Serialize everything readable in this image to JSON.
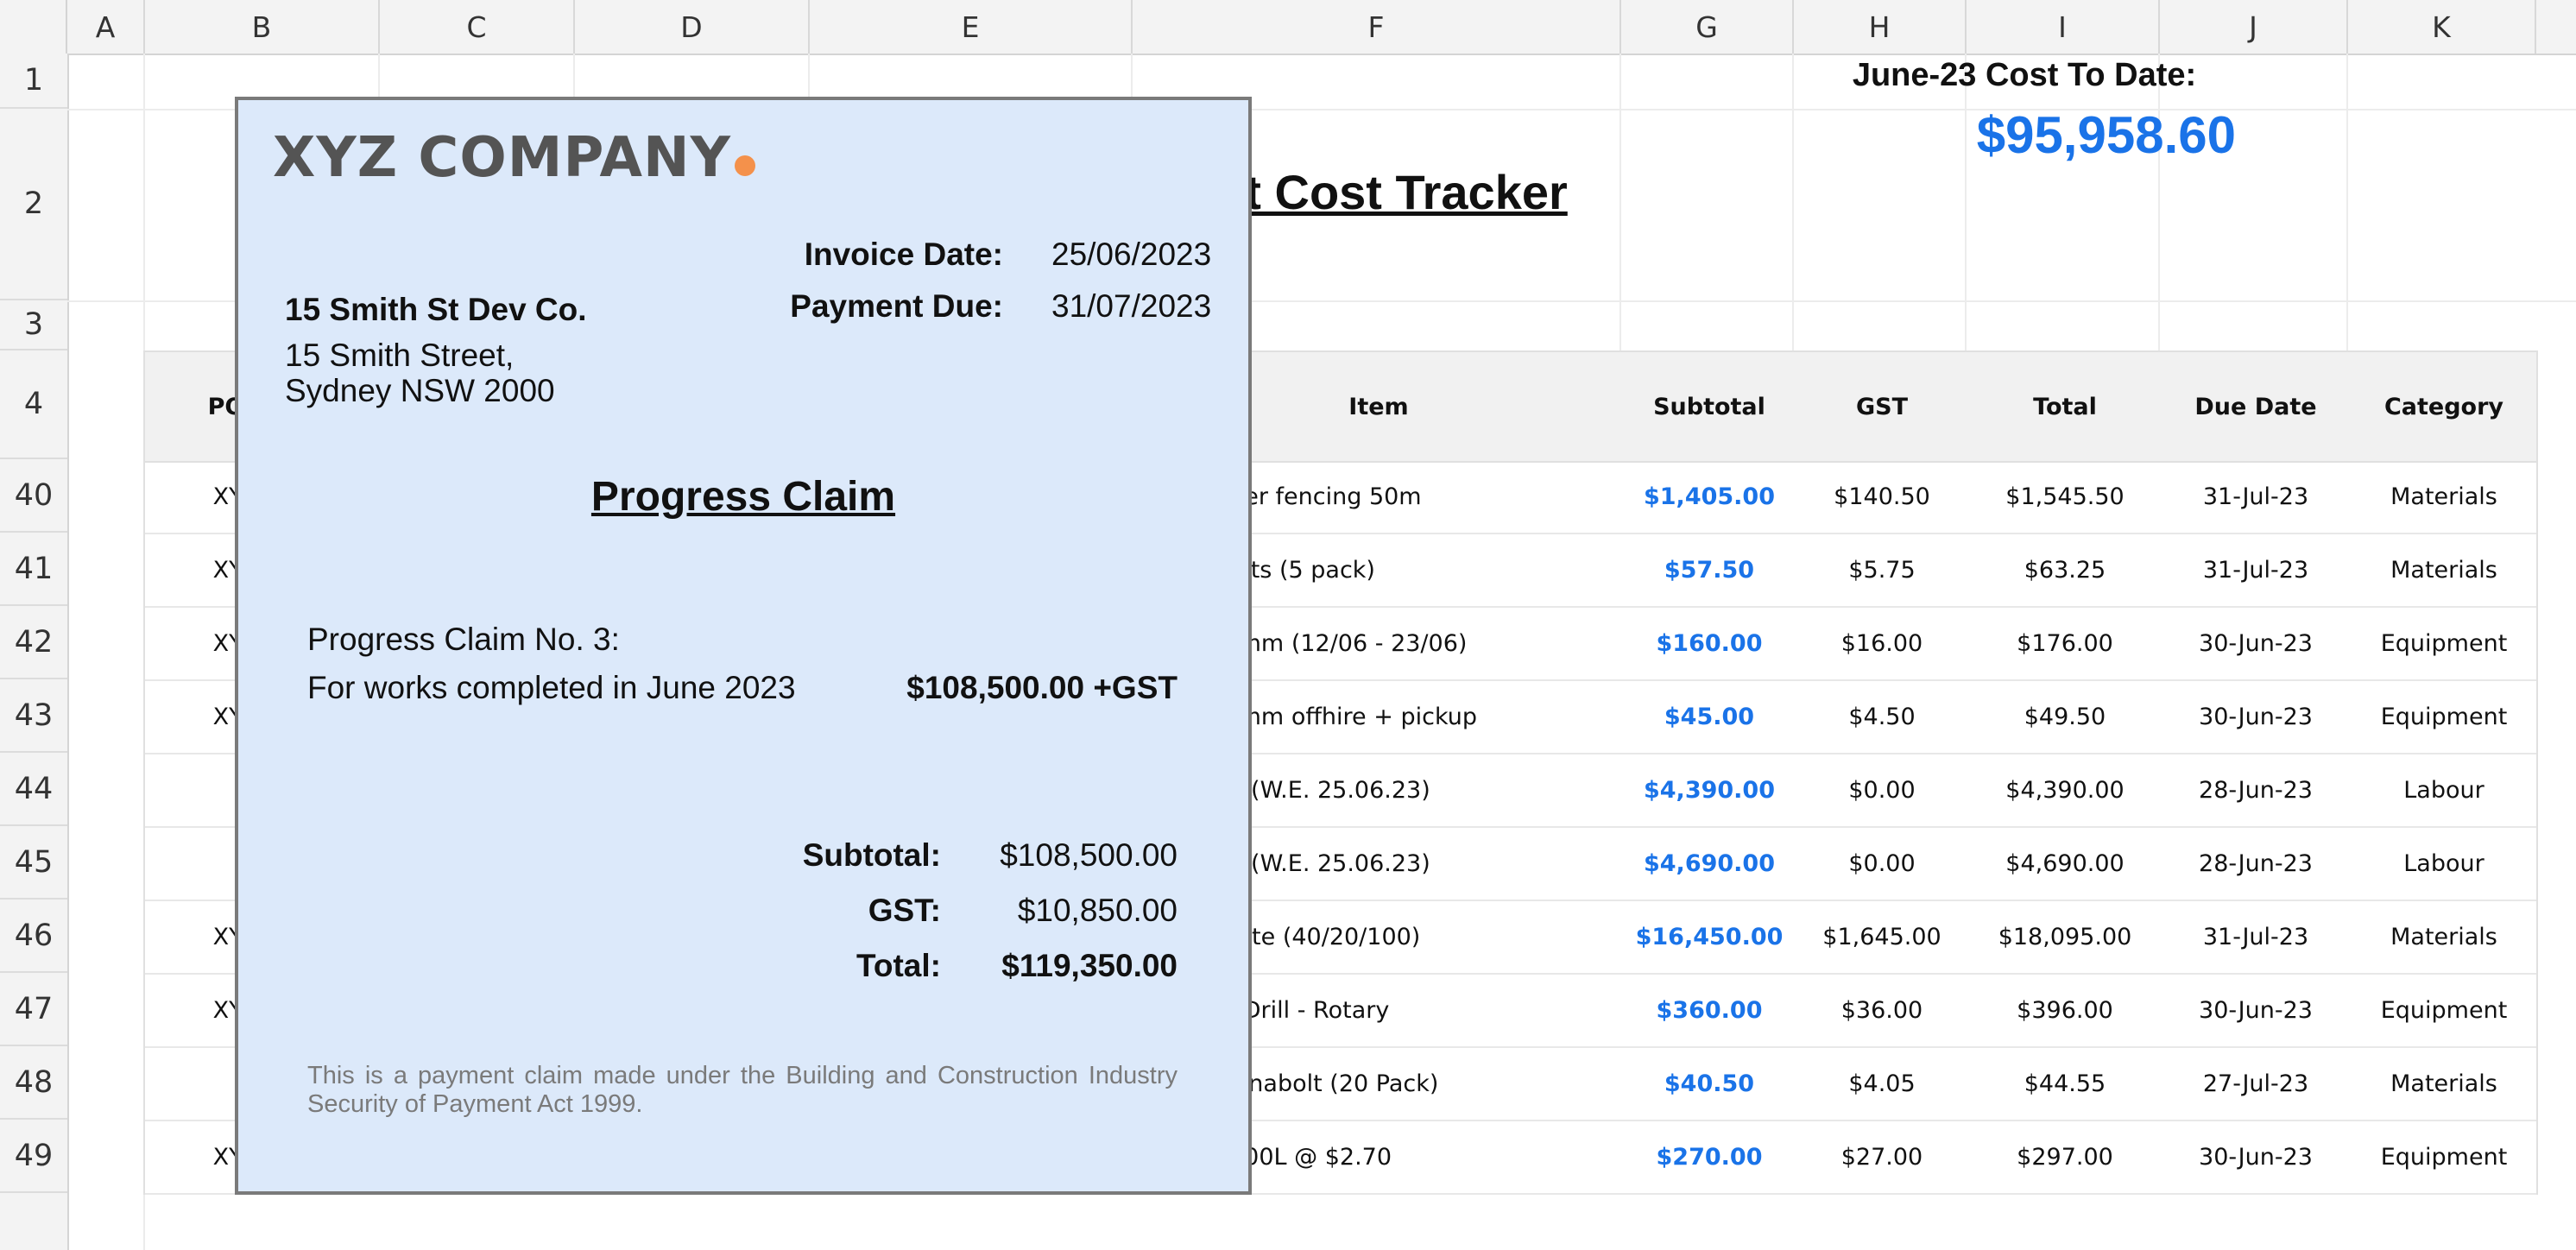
{
  "columns": [
    "A",
    "B",
    "C",
    "D",
    "E",
    "F",
    "G",
    "H",
    "I",
    "J",
    "K"
  ],
  "rows": [
    "1",
    "2",
    "3",
    "4",
    "40",
    "41",
    "42",
    "43",
    "44",
    "45",
    "46",
    "47",
    "48",
    "49"
  ],
  "cost_to_date": {
    "label": "June-23 Cost To Date:",
    "value": "$95,958.60"
  },
  "sheet_title": "ect Cost Tracker",
  "table": {
    "headers": {
      "po": "PO N",
      "item": "Item",
      "subtotal": "Subtotal",
      "gst": "GST",
      "total": "Total",
      "due": "Due Date",
      "category": "Category"
    },
    "rows": [
      {
        "po": "XYZ-",
        "item": "owd barrier fencing 50m",
        "subtotal": "$1,405.00",
        "gst": "$140.50",
        "total": "$1,545.50",
        "due": "31-Jul-23",
        "category": "Materials"
      },
      {
        "po": "XYZ-",
        "item": "Star pickets (5 pack)",
        "subtotal": "$57.50",
        "gst": "$5.75",
        "total": "$63.25",
        "due": "31-Jul-23",
        "category": "Materials"
      },
      {
        "po": "XYZ-",
        "item": "pump 50mm (12/06 - 23/06)",
        "subtotal": "$160.00",
        "gst": "$16.00",
        "total": "$176.00",
        "due": "30-Jun-23",
        "category": "Equipment"
      },
      {
        "po": "XYZ-",
        "item": "pump 50mm offhire + pickup",
        "subtotal": "$45.00",
        "gst": "$4.50",
        "total": "$49.50",
        "due": "30-Jun-23",
        "category": "Equipment"
      },
      {
        "po": "",
        "item": "bour cost (W.E. 25.06.23)",
        "subtotal": "$4,390.00",
        "gst": "$0.00",
        "total": "$4,390.00",
        "due": "28-Jun-23",
        "category": "Labour"
      },
      {
        "po": "",
        "item": "bour cost (W.E. 25.06.23)",
        "subtotal": "$4,690.00",
        "gst": "$0.00",
        "total": "$4,690.00",
        "due": "28-Jun-23",
        "category": "Labour"
      },
      {
        "po": "XYZ-",
        "item": "PA Concrete (40/20/100)",
        "subtotal": "$16,450.00",
        "gst": "$1,645.00",
        "total": "$18,095.00",
        "due": "31-Jul-23",
        "category": "Materials"
      },
      {
        "po": "XYZ-",
        "item": "Hammer Drill - Rotary",
        "subtotal": "$360.00",
        "gst": "$36.00",
        "total": "$396.00",
        "due": "30-Jun-23",
        "category": "Equipment"
      },
      {
        "po": "",
        "item": "00mm Dynabolt (20 Pack)",
        "subtotal": "$40.50",
        "gst": "$4.05",
        "total": "$44.55",
        "due": "27-Jul-23",
        "category": "Materials"
      },
      {
        "po": "XYZ-",
        "item": "Diesel - 100L @ $2.70",
        "subtotal": "$270.00",
        "gst": "$27.00",
        "total": "$297.00",
        "due": "30-Jun-23",
        "category": "Equipment"
      }
    ]
  },
  "invoice": {
    "company": "XYZ COMPANY",
    "invoice_date_label": "Invoice Date:",
    "invoice_date": "25/06/2023",
    "payment_due_label": "Payment Due:",
    "payment_due": "31/07/2023",
    "client_name": "15 Smith St Dev Co.",
    "address_line1": "15 Smith Street,",
    "address_line2": "Sydney NSW 2000",
    "heading": "Progress Claim",
    "claim_no": "Progress Claim No. 3:",
    "claim_desc": "For works completed in June 2023",
    "claim_amount": "$108,500.00 +GST",
    "subtotal_label": "Subtotal:",
    "subtotal": "$108,500.00",
    "gst_label": "GST:",
    "gst": "$10,850.00",
    "total_label": "Total:",
    "total": "$119,350.00",
    "footer": "This is a payment claim made under the Building and Construction Industry Security of Payment Act 1999.",
    "accent_color": "#f4914b"
  },
  "colors": {
    "accent_blue": "#1a73e8",
    "invoice_bg": "#dce9fa"
  }
}
